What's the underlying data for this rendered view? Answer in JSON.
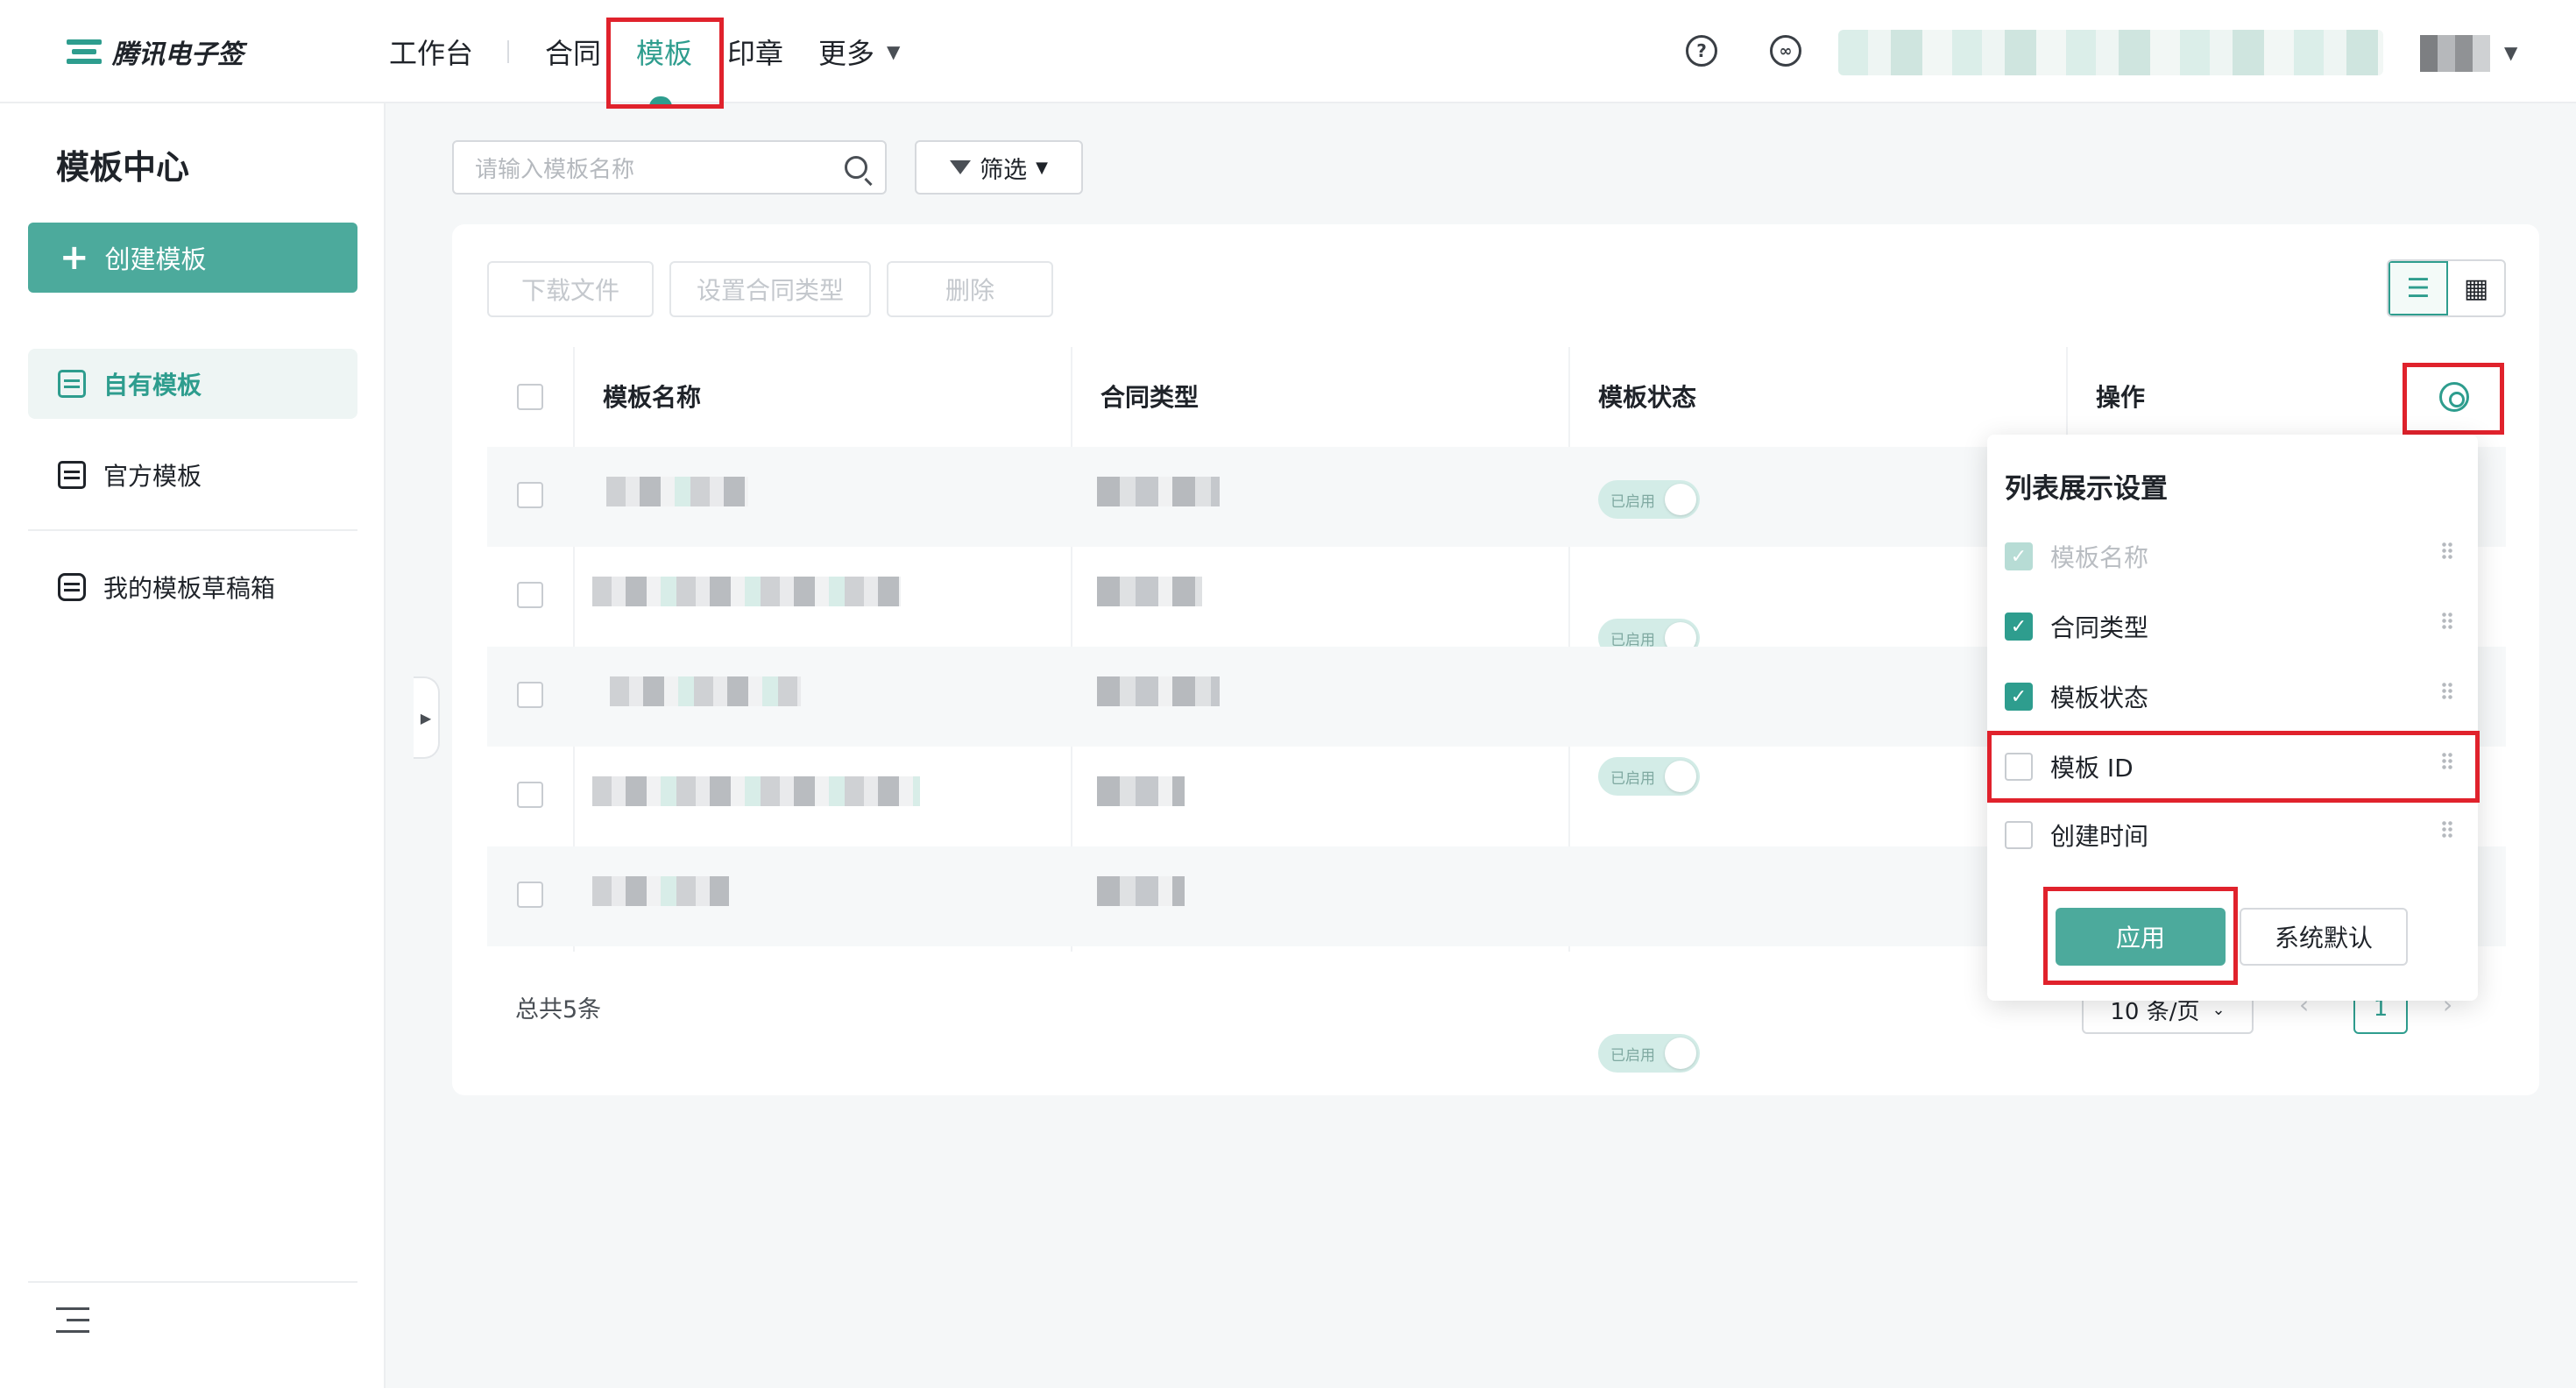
{
  "header": {
    "logo_text": "腾讯电子签",
    "nav": [
      "工作台",
      "合同",
      "模板",
      "印章",
      "更多"
    ],
    "help_icon": "question-circle-icon",
    "link_icon": "link-circle-icon"
  },
  "sidebar": {
    "title": "模板中心",
    "create_button": "创建模板",
    "items": [
      {
        "label": "自有模板",
        "active": true,
        "icon": "template-list-icon"
      },
      {
        "label": "官方模板",
        "active": false,
        "icon": "official-template-icon"
      },
      {
        "label": "我的模板草稿箱",
        "active": false,
        "icon": "draft-box-icon"
      }
    ]
  },
  "search": {
    "placeholder": "请输入模板名称"
  },
  "filter": {
    "label": "筛选"
  },
  "toolbar": {
    "download": "下载文件",
    "set_type": "设置合同类型",
    "delete": "删除"
  },
  "table": {
    "headers": {
      "name": "模板名称",
      "type": "合同类型",
      "status": "模板状态",
      "action": "操作"
    },
    "status_label": "已启用",
    "row_count": 5
  },
  "footer": {
    "total": "总共5条",
    "page_size": "10 条/页",
    "current_page": "1"
  },
  "popup": {
    "title": "列表展示设置",
    "options": [
      {
        "label": "模板名称",
        "checked": true,
        "disabled": true
      },
      {
        "label": "合同类型",
        "checked": true,
        "disabled": false
      },
      {
        "label": "模板状态",
        "checked": true,
        "disabled": false
      },
      {
        "label": "模板 ID",
        "checked": false,
        "disabled": false
      },
      {
        "label": "创建时间",
        "checked": false,
        "disabled": false
      }
    ],
    "apply": "应用",
    "reset": "系统默认"
  },
  "colors": {
    "brand": "#2e9d8e",
    "highlight": "#e0222c"
  }
}
